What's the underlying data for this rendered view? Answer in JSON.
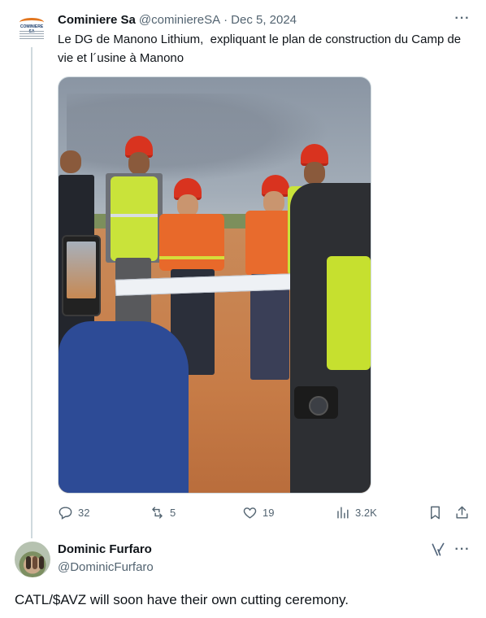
{
  "tweet1": {
    "author_name": "Cominiere Sa",
    "author_handle": "@cominiereSA",
    "separator": "·",
    "date": "Dec 5, 2024",
    "avatar_icon": "cominiere-logo-icon",
    "avatar_logo_text": "COMINIERE SA",
    "text": "Le DG de Manono Lithium,  expliquant le plan de construction du Camp de vie et l´usine à Manono",
    "image_icon": "site-visit-photo",
    "actions": {
      "replies": "32",
      "retweets": "5",
      "likes": "19",
      "views": "3.2K"
    }
  },
  "tweet2": {
    "author_name": "Dominic Furfaro",
    "author_handle": "@DominicFurfaro",
    "text": "CATL/$AVZ will soon have their own cutting ceremony.",
    "grok_icon": "grok-icon"
  },
  "colors": {
    "text": "#0f1419",
    "muted": "#536471",
    "border": "#cfd9de"
  }
}
